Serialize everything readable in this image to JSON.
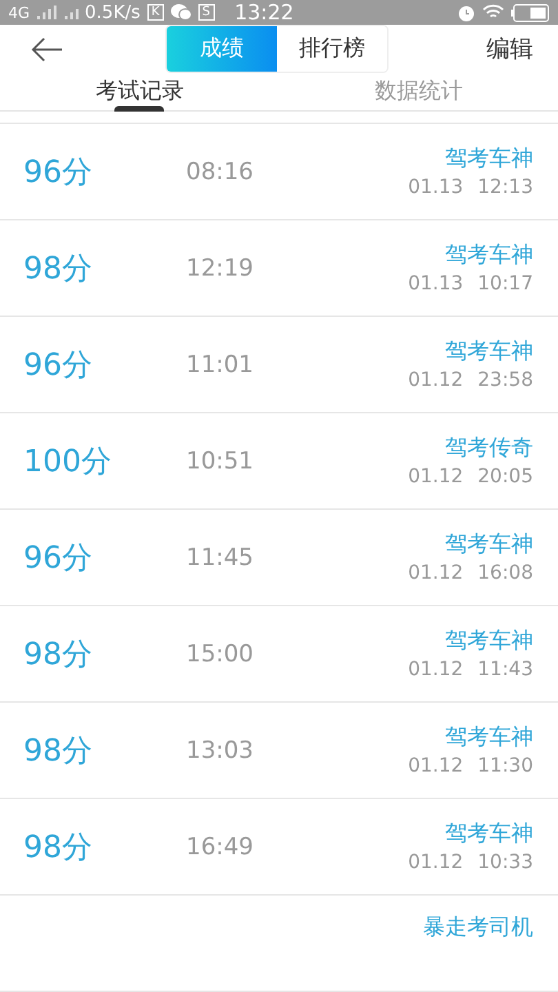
{
  "status_bar": {
    "network": "4G",
    "speed": "0.5K/s",
    "badges": [
      "K",
      "S"
    ],
    "time": "13:22"
  },
  "header": {
    "segments": [
      {
        "label": "成绩",
        "selected": true
      },
      {
        "label": "排行榜",
        "selected": false
      }
    ],
    "action": "编辑"
  },
  "tabs": [
    {
      "label": "考试记录",
      "selected": true
    },
    {
      "label": "数据统计",
      "selected": false
    }
  ],
  "records": [
    {
      "score": "96分",
      "duration": "08:16",
      "title": "驾考车神",
      "date": "01.13",
      "time": "12:13"
    },
    {
      "score": "98分",
      "duration": "12:19",
      "title": "驾考车神",
      "date": "01.13",
      "time": "10:17"
    },
    {
      "score": "96分",
      "duration": "11:01",
      "title": "驾考车神",
      "date": "01.12",
      "time": "23:58"
    },
    {
      "score": "100分",
      "duration": "10:51",
      "title": "驾考传奇",
      "date": "01.12",
      "time": "20:05"
    },
    {
      "score": "96分",
      "duration": "11:45",
      "title": "驾考车神",
      "date": "01.12",
      "time": "16:08"
    },
    {
      "score": "98分",
      "duration": "15:00",
      "title": "驾考车神",
      "date": "01.12",
      "time": "11:43"
    },
    {
      "score": "98分",
      "duration": "13:03",
      "title": "驾考车神",
      "date": "01.12",
      "time": "11:30"
    },
    {
      "score": "98分",
      "duration": "16:49",
      "title": "驾考车神",
      "date": "01.12",
      "time": "10:33"
    }
  ],
  "partial_record": {
    "title": "暴走考司机"
  }
}
